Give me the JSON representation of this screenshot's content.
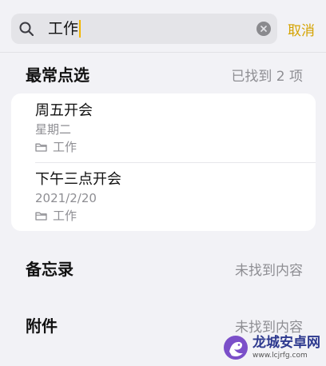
{
  "search": {
    "query": "工作",
    "cancel_label": "取消"
  },
  "top_hits": {
    "title": "最常点选",
    "count_text": "已找到 2 项",
    "items": [
      {
        "title": "周五开会",
        "date": "星期二",
        "folder": "工作"
      },
      {
        "title": "下午三点开会",
        "date": "2021/2/20",
        "folder": "工作"
      }
    ]
  },
  "notes_section": {
    "title": "备忘录",
    "status": "未找到内容"
  },
  "attachments_section": {
    "title": "附件",
    "status": "未找到内容"
  },
  "watermark": {
    "name": "龙城安卓网",
    "url": "www.lcjrfg.com"
  },
  "colors": {
    "accent": "#d5a300",
    "background": "#f2f2f6",
    "secondary_text": "#8e8e93"
  }
}
